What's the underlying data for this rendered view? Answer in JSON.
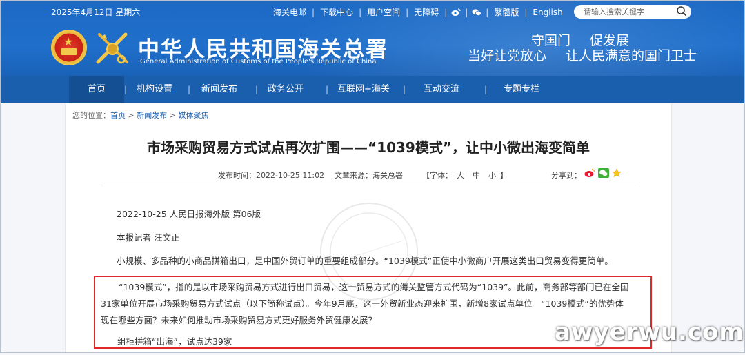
{
  "topbar": {
    "date": "2025年4月12日 星期六",
    "links": [
      "海关电邮",
      "下载中心",
      "用户空间",
      "无障碍"
    ],
    "lang_cn": "繁體版",
    "lang_en": "English",
    "search_placeholder": "请输入搜索关键字"
  },
  "header": {
    "title_cn": "中华人民共和国海关总署",
    "title_en": "General Administration of Customs of the People's Republic of China",
    "slogan_line1_a": "守国门",
    "slogan_line1_b": "促发展",
    "slogan_line2_a": "当好让党放心",
    "slogan_line2_b": "让人民满意的国门卫士"
  },
  "nav": {
    "items": [
      "首页",
      "机构设置",
      "新闻发布",
      "政务公开",
      "互联网+海关",
      "互动交流",
      "专题专栏"
    ]
  },
  "breadcrumb": {
    "prefix": "您的位置：",
    "home": "首页",
    "sep": " > ",
    "news": "新闻发布",
    "current": "媒体聚焦"
  },
  "article": {
    "title": "市场采购贸易方式试点再次扩围——“1039模式”，让中小微出海变简单",
    "publish_time": "发布时间：2022-10-25 11:02",
    "source": "文章来源：海关总署",
    "font_label": "【字体：",
    "font_sizes": [
      "大",
      "中",
      "小"
    ],
    "font_close": "】",
    "share_label": "分享到：",
    "p1": "2022-10-25   人民日报海外版   第06版",
    "p2": "本报记者  汪文正",
    "p3": "小规模、多品种的小商品拼箱出口，是中国外贸订单的重要组成部分。“1039模式”正使中小微商户开展这类出口贸易变得更简单。",
    "p4": "“1039模式”，指的是以市场采购贸易方式进行出口贸易，这一贸易方式的海关监管方式代码为“1039”。此前，商务部等部门已在全国31家单位开展市场采购贸易方式试点（以下简称试点）。今年9月底，这一外贸新业态迎来扩围，新增8家试点单位。“1039模式”的优势体现在哪些方面？未来如何推动市场采购贸易方式更好服务外贸健康发展？",
    "p5": "组柜拼箱“出海”，试点达39家"
  },
  "watermarks": {
    "site": "awyerwu.com"
  },
  "colors": {
    "banner_blue": "#1f6fcb",
    "nav_blue": "#1a5fae",
    "highlight_red": "#e02828"
  }
}
